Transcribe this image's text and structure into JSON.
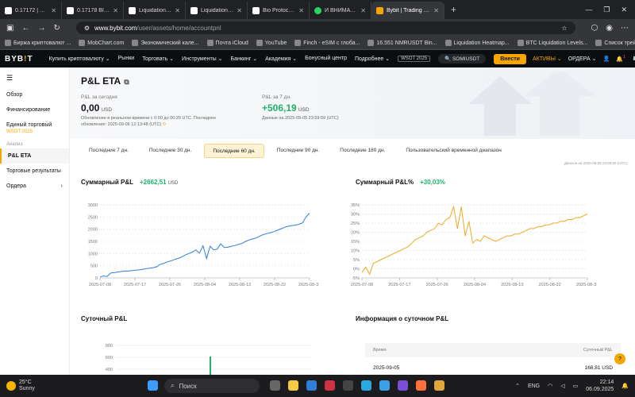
{
  "browser": {
    "tabs": [
      {
        "title": "0.17172 | Трейдинг",
        "fav": "white"
      },
      {
        "title": "0.17178 BIOUSDT Bybit",
        "fav": "white"
      },
      {
        "title": "Liquidation Heatmap",
        "fav": "white"
      },
      {
        "title": "Liquidation Heatmap",
        "fav": "white"
      },
      {
        "title": "Bio Protocol (BIO) C",
        "fav": "white"
      },
      {
        "title": "И ВНИМАТЕЛЬНЫЙ",
        "fav": "green"
      },
      {
        "title": "Bybit | Trading Platform",
        "fav": "orange",
        "active": true
      }
    ],
    "url_host": "www.bybit.com",
    "url_path": "/user/assets/home/accountpnl",
    "bookmarks": [
      "Биржа криптовалют ...",
      "MobChart.com",
      "Экономический кале...",
      "Почта iCloud",
      "YouTube",
      "Finch - eSIM с глоба...",
      "16.551 NMRUSDT Bin...",
      "Liquidation Heatmap...",
      "BTC Liquidation Levels...",
      "Список трейнеров"
    ]
  },
  "nav": {
    "logo_main": "BYB",
    "logo_accent": "!",
    "logo_end": "T",
    "items": [
      "Купить криптовалюту ⌄",
      "Рынки",
      "Торговать ⌄",
      "Инструменты ⌄",
      "Банкинг ⌄",
      "Академия ⌄",
      "Бонусный центр",
      "Подробнее ⌄"
    ],
    "badge": "WSOT 2025",
    "search": "SOMIUSDT",
    "login": "Внести",
    "assets": "АКТИВЫ ⌄",
    "orders": "ОРДЕРА ⌄",
    "bell_count": "1"
  },
  "sidebar": {
    "items": [
      {
        "label": "Обзор",
        "active": false,
        "chevron": ""
      },
      {
        "label": "Финансирование",
        "active": false,
        "chevron": ""
      },
      {
        "label": "Единый торговый",
        "active": false,
        "chevron": ""
      }
    ],
    "unified_sub": "WSOT 2025",
    "section": "Анализ",
    "pnl_item": "P&L ETA",
    "trade_results": "Торговые результаты",
    "orders": "Ордера",
    "orders_chevron": "›"
  },
  "header": {
    "title": "P&L ETA",
    "today_label": "P&L за сегодня",
    "today_value": "0,00",
    "today_cur": "USD",
    "today_note1": "Обновление в реальном времени с 0:00 до 00:20 UTC. Последнее",
    "today_note2": "обновление: 2025-09-06 12:13:48 (UTC)",
    "week_label": "P&L за 7 дн.",
    "week_value": "+506,19",
    "week_cur": "USD",
    "week_note": "Данные на 2025-09-05 23:59:59 (UTC)"
  },
  "periods": [
    "Последние 7 дн.",
    "Последние 30 дн.",
    "Последние 60 дн.",
    "Последние 90 дн.",
    "Последние 180 дн.",
    "Пользовательский временной диапазон"
  ],
  "selected_period": 2,
  "footnote": "Данные на 2025-09-05 23:59:59 (UTC)",
  "charts": {
    "left_title": "Суммарный P&L",
    "left_value": "+2662,51",
    "left_cur": "USD",
    "right_title": "Суммарный P&L%",
    "right_value": "+30,03%"
  },
  "chart_data": [
    {
      "type": "line",
      "title": "Суммарный P&L",
      "color": "#2f7fd8",
      "x_ticks": [
        "2025-07-08",
        "2025-07-17",
        "2025-07-26",
        "2025-08-04",
        "2025-08-13",
        "2025-08-22",
        "2025-08-31"
      ],
      "y_ticks": [
        "0",
        "500",
        "1000",
        "1500",
        "2000",
        "2500",
        "3000"
      ],
      "ylim": [
        0,
        3000
      ],
      "x": [
        0,
        1,
        2,
        3,
        4,
        5,
        6,
        7,
        8,
        9,
        10,
        11,
        12,
        13,
        14,
        15,
        16,
        17,
        18,
        19,
        20,
        21,
        22,
        23,
        24,
        25,
        26,
        27,
        28,
        29,
        30,
        31,
        32,
        33,
        34,
        35,
        36,
        37,
        38,
        39,
        40,
        41,
        42,
        43,
        44,
        45,
        46,
        47,
        48,
        49,
        50,
        51,
        52,
        53,
        54,
        55,
        56,
        57,
        58,
        59
      ],
      "values": [
        40,
        80,
        60,
        200,
        220,
        240,
        260,
        280,
        280,
        300,
        320,
        330,
        350,
        380,
        400,
        420,
        460,
        560,
        600,
        660,
        700,
        760,
        800,
        860,
        940,
        1000,
        1060,
        1150,
        1020,
        1320,
        800,
        1300,
        1150,
        1180,
        1400,
        1250,
        1260,
        1300,
        1330,
        1380,
        1420,
        1500,
        1560,
        1600,
        1640,
        1720,
        1780,
        1820,
        1860,
        1900,
        1960,
        2020,
        2080,
        2120,
        2150,
        2170,
        2200,
        2260,
        2500,
        2660
      ]
    },
    {
      "type": "line",
      "title": "Суммарный P&L%",
      "color": "#f0a81e",
      "x_ticks": [
        "2025-07-08",
        "2025-07-17",
        "2025-07-26",
        "2025-08-04",
        "2025-08-13",
        "2025-08-22",
        "2025-08-31"
      ],
      "y_ticks": [
        "-5%",
        "0%",
        "5%",
        "10%",
        "15%",
        "20%",
        "25%",
        "30%",
        "35%"
      ],
      "ylim": [
        -5,
        35
      ],
      "x": [
        0,
        1,
        2,
        3,
        4,
        5,
        6,
        7,
        8,
        9,
        10,
        11,
        12,
        13,
        14,
        15,
        16,
        17,
        18,
        19,
        20,
        21,
        22,
        23,
        24,
        25,
        26,
        27,
        28,
        29,
        30,
        31,
        32,
        33,
        34,
        35,
        36,
        37,
        38,
        39,
        40,
        41,
        42,
        43,
        44,
        45,
        46,
        47,
        48,
        49,
        50,
        51,
        52,
        53,
        54,
        55,
        56,
        57,
        58,
        59
      ],
      "values": [
        -2,
        1,
        -3,
        3,
        4,
        5,
        6,
        7,
        8,
        9,
        10,
        11,
        12,
        14,
        16,
        17,
        18,
        20,
        21,
        22,
        25,
        24,
        27,
        28,
        34,
        22,
        34,
        18,
        26,
        14,
        16,
        15,
        18,
        17,
        16,
        15,
        16,
        17,
        18,
        18,
        19,
        19,
        20,
        21,
        22,
        22,
        23,
        23,
        24,
        24,
        25,
        25,
        26,
        26,
        27,
        27,
        28,
        28,
        29,
        30
      ]
    }
  ],
  "daily": {
    "title": "Суточный P&L",
    "y_ticks": [
      "800",
      "600",
      "400"
    ],
    "info_title": "Информация о суточном P&L",
    "col_time": "Время",
    "col_pnl": "Суточный P&L",
    "row_date": "2025-09-05",
    "row_value": "168,81 USD"
  },
  "taskbar": {
    "temp": "25°C",
    "weather": "Sunny",
    "search": "Поиск",
    "lang": "ENG",
    "time": "22:14",
    "date": "06.09.2025"
  }
}
